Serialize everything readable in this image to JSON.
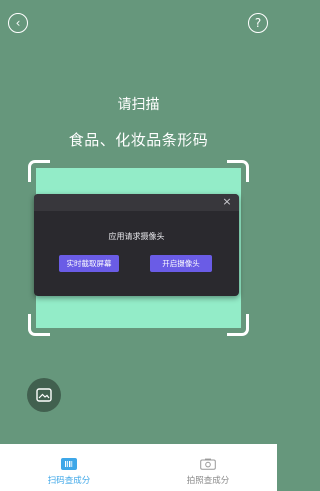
{
  "header": {
    "back_glyph": "‹",
    "help_glyph": "?"
  },
  "scanner": {
    "title_line1": "请扫描",
    "title_line2": "食品、化妆品条形码"
  },
  "dialog": {
    "close_glyph": "×",
    "message": "应用请求摄像头",
    "capture_label": "实时截取屏幕",
    "camera_label": "开启摄像头"
  },
  "tabbar": {
    "tabs": [
      {
        "label": "扫码查成分",
        "icon": "barcode-icon",
        "active": true
      },
      {
        "label": "拍照查成分",
        "icon": "camera-icon",
        "active": false
      }
    ]
  },
  "colors": {
    "background": "#66977c",
    "scan_area": "#93ecc8",
    "dialog_button": "#6a5ce6",
    "tab_active": "#3ea7e8",
    "tab_inactive": "#8a8a8a"
  }
}
